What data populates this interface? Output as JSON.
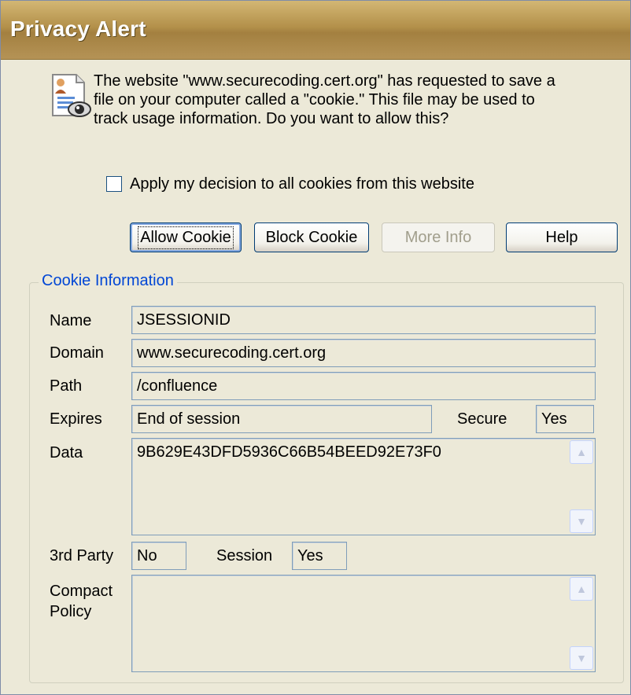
{
  "window": {
    "title": "Privacy Alert"
  },
  "message": "The website \"www.securecoding.cert.org\" has requested to save a\nfile on your computer called a \"cookie.\"  This file may be used to\ntrack usage information. Do you want to allow this?",
  "checkbox": {
    "label": "Apply my decision to all cookies from this website",
    "checked": false
  },
  "buttons": {
    "allow": "Allow Cookie",
    "block": "Block Cookie",
    "more_info": "More Info",
    "help": "Help"
  },
  "cookie_info": {
    "title": "Cookie Information",
    "labels": {
      "name": "Name",
      "domain": "Domain",
      "path": "Path",
      "expires": "Expires",
      "secure": "Secure",
      "data": "Data",
      "third_party": "3rd Party",
      "session": "Session",
      "compact_policy": "Compact\nPolicy"
    },
    "values": {
      "name": "JSESSIONID",
      "domain": "www.securecoding.cert.org",
      "path": "/confluence",
      "expires": "End of session",
      "secure": "Yes",
      "data": "9B629E43DFD5936C66B54BEED92E73F0",
      "third_party": "No",
      "session": "Yes",
      "compact_policy": ""
    }
  },
  "icons": {
    "info": "privacy-report-icon",
    "scroll_up": "scroll-up-arrow-icon",
    "scroll_down": "scroll-down-arrow-icon"
  },
  "colors": {
    "title_bar": "#b3904a",
    "group_title": "#0046d5",
    "face": "#ece9d8"
  }
}
